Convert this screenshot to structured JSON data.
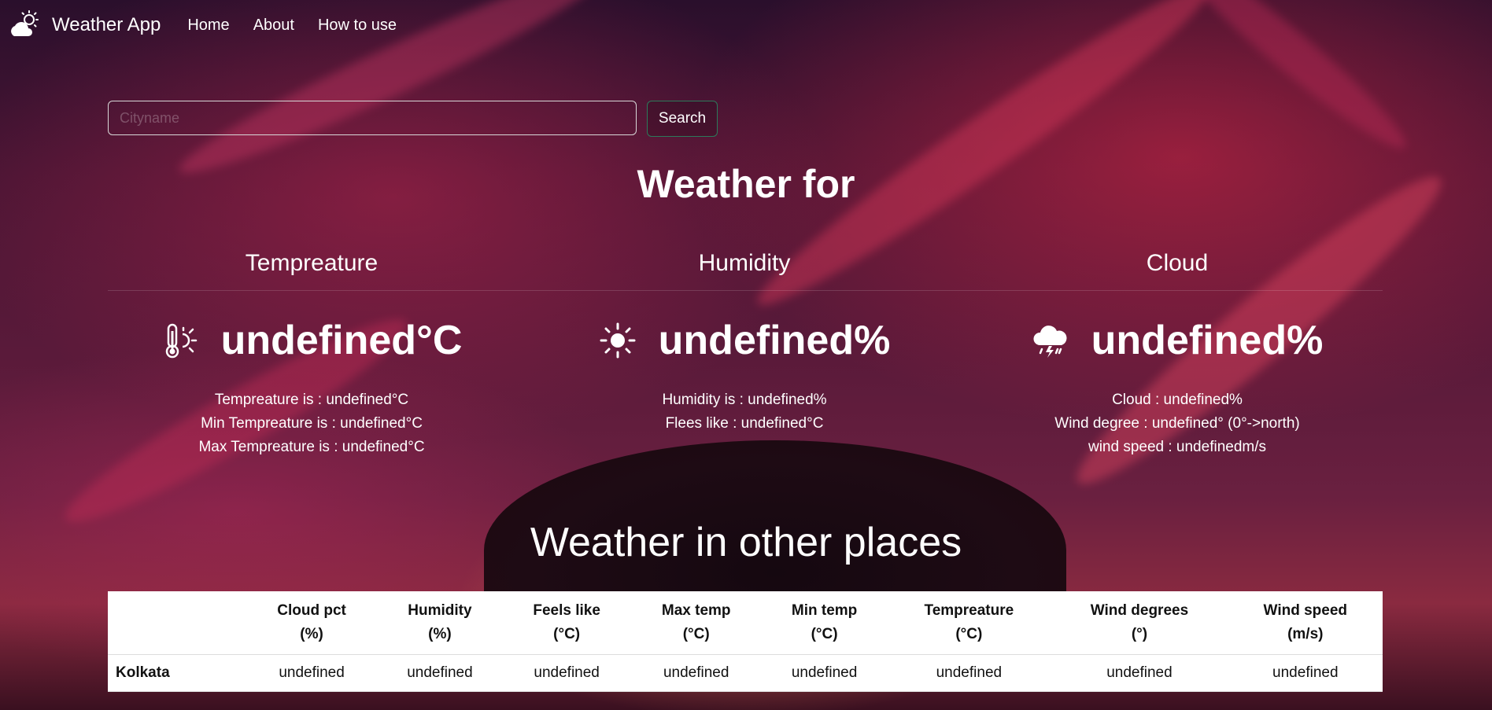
{
  "navbar": {
    "brand": "Weather App",
    "brand_icon": "cloud-sun-icon",
    "links": [
      "Home",
      "About",
      "How to use"
    ]
  },
  "search": {
    "placeholder": "Cityname",
    "value": "",
    "button_label": "Search"
  },
  "main": {
    "title": "Weather for",
    "temperature": {
      "header": "Tempreature",
      "value": "undefined°C",
      "icon": "thermometer-sun-icon",
      "details": [
        "Tempreature is : undefined°C",
        "Min Tempreature is : undefined°C",
        "Max Tempreature is : undefined°C"
      ]
    },
    "humidity": {
      "header": "Humidity",
      "value": "undefined%",
      "icon": "sun-icon",
      "details": [
        "Humidity is : undefined%",
        "Flees like : undefined°C"
      ]
    },
    "cloud": {
      "header": "Cloud",
      "value": "undefined%",
      "icon": "cloud-lightning-rain-icon",
      "details": [
        "Cloud : undefined%",
        "Wind degree : undefined° (0°->north)",
        "wind speed : undefinedm/s"
      ]
    }
  },
  "other_places": {
    "title": "Weather in other places",
    "columns": [
      {
        "name": "Cloud pct",
        "unit": "(%)"
      },
      {
        "name": "Humidity",
        "unit": "(%)"
      },
      {
        "name": "Feels like",
        "unit": "(°C)"
      },
      {
        "name": "Max temp",
        "unit": "(°C)"
      },
      {
        "name": "Min temp",
        "unit": "(°C)"
      },
      {
        "name": "Tempreature",
        "unit": "(°C)"
      },
      {
        "name": "Wind degrees",
        "unit": "(°)"
      },
      {
        "name": "Wind speed",
        "unit": "(m/s)"
      }
    ],
    "rows": [
      {
        "city": "Kolkata",
        "values": [
          "undefined",
          "undefined",
          "undefined",
          "undefined",
          "undefined",
          "undefined",
          "undefined",
          "undefined"
        ]
      }
    ]
  }
}
